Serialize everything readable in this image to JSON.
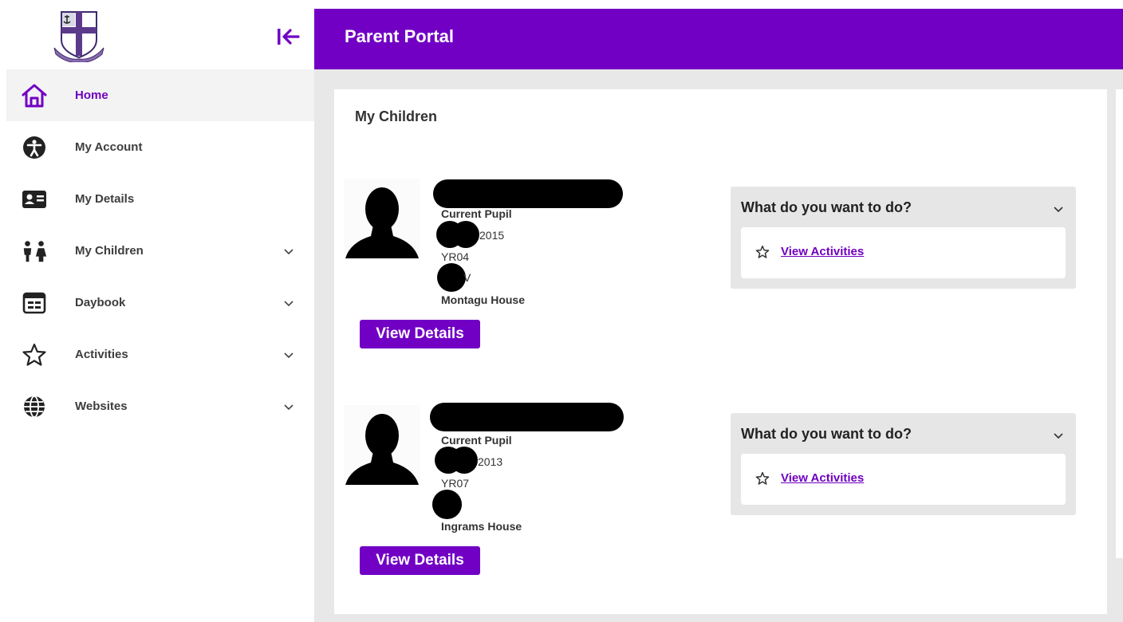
{
  "app": {
    "title": "Parent Portal"
  },
  "sidebar": {
    "items": [
      {
        "label": "Home",
        "icon": "home-icon",
        "active": true,
        "expandable": false
      },
      {
        "label": "My Account",
        "icon": "accessibility-icon",
        "active": false,
        "expandable": false
      },
      {
        "label": "My Details",
        "icon": "id-card-icon",
        "active": false,
        "expandable": false
      },
      {
        "label": "My Children",
        "icon": "children-icon",
        "active": false,
        "expandable": true
      },
      {
        "label": "Daybook",
        "icon": "daybook-icon",
        "active": false,
        "expandable": true
      },
      {
        "label": "Activities",
        "icon": "star-icon",
        "active": false,
        "expandable": true
      },
      {
        "label": "Websites",
        "icon": "globe-icon",
        "active": false,
        "expandable": true
      }
    ]
  },
  "main": {
    "section_title": "My Children",
    "children": [
      {
        "status": "Current Pupil",
        "dob_partial": "2015",
        "year_group": "YR04",
        "form_partial": "V",
        "house": "Montagu House",
        "view_details_label": "View Details",
        "actions_title": "What do you want to do?",
        "action_link": "View Activities"
      },
      {
        "status": "Current Pupil",
        "dob_partial": "2013",
        "year_group": "YR07",
        "form_partial": "",
        "house": "Ingrams House",
        "view_details_label": "View Details",
        "actions_title": "What do you want to do?",
        "action_link": "View Activities"
      }
    ]
  },
  "colors": {
    "brand_purple": "#7100c4",
    "link_purple": "#6f00c0",
    "panel_grey": "#e6e6e6",
    "background_grey": "#e8e8e8"
  }
}
